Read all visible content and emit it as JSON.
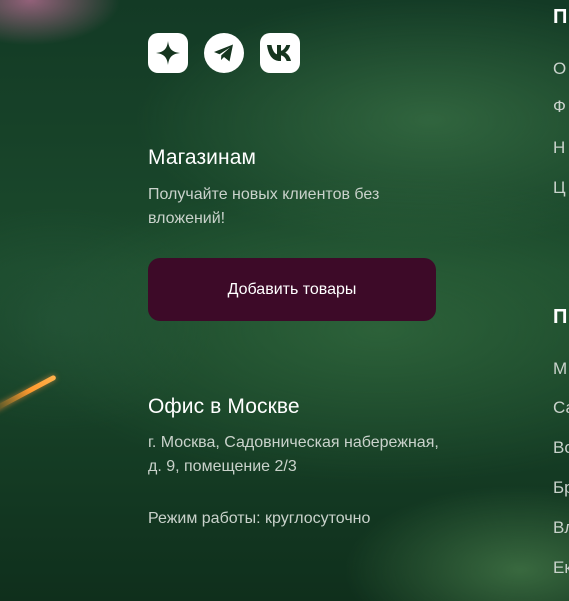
{
  "social": {
    "items": [
      {
        "name": "sparkle",
        "icon": "sparkle-icon"
      },
      {
        "name": "telegram",
        "icon": "telegram-icon"
      },
      {
        "name": "vk",
        "icon": "vk-icon"
      }
    ]
  },
  "shops": {
    "title": "Магазинам",
    "text": "Получайте новых клиентов без вложений!",
    "button_label": "Добавить товары"
  },
  "office": {
    "title": "Офис в Москве",
    "address": "г. Москва, Садовническая набережная, д. 9, помещение 2/3",
    "hours": "Режим работы: круглосуточно"
  },
  "right_column": {
    "heading_1": "П",
    "items_1": [
      "О",
      "Ф",
      "Н",
      "Ц"
    ],
    "heading_2": "П",
    "items_2": [
      "М",
      "Са",
      "Во",
      "Бр",
      "Вл",
      "Ек"
    ]
  },
  "colors": {
    "background": "#1b4a2c",
    "button": "#3d0a28",
    "muted_text": "#c9d2cb",
    "icon_bg": "#ffffff"
  }
}
